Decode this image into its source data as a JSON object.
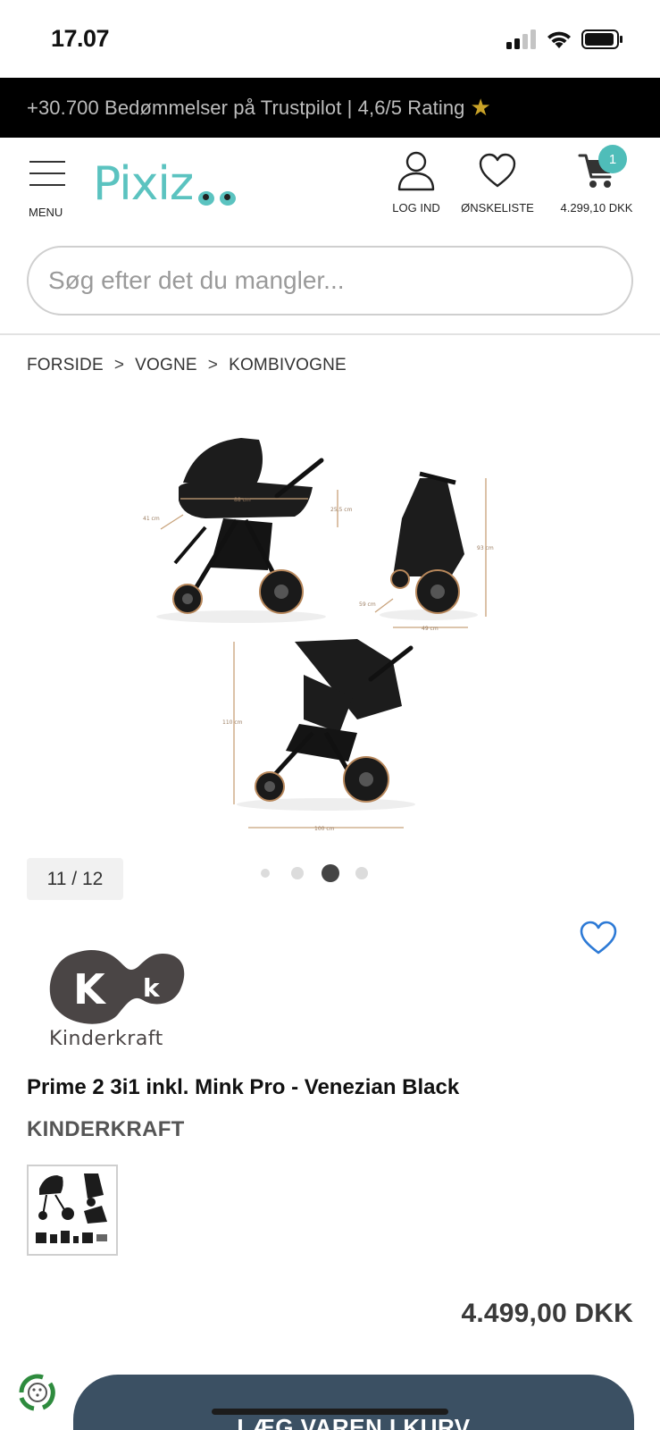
{
  "status_bar": {
    "time": "17.07",
    "icons": [
      "signal-icon",
      "wifi-icon",
      "battery-icon"
    ]
  },
  "promo": {
    "text": "+30.700 Bedømmelser på Trustpilot | 4,6/5 Rating",
    "star": "★"
  },
  "header": {
    "menu_label": "MENU",
    "logo_text": "Pixiz",
    "login_label": "LOG IND",
    "wishlist_label": "ØNSKELISTE",
    "cart_total": "4.299,10 DKK",
    "cart_count": "1",
    "brand_color": "#5bc3c0"
  },
  "search": {
    "placeholder": "Søg efter det du mangler..."
  },
  "breadcrumb": {
    "items": [
      "FORSIDE",
      "VOGNE",
      "KOMBIVOGNE"
    ],
    "separator": ">"
  },
  "gallery": {
    "counter": "11 / 12",
    "dims": {
      "carrycot_length": "88 cm",
      "carrycot_height": "25,5 cm",
      "carrycot_width": "41 cm",
      "folded_height": "93 cm",
      "folded_depth": "59 cm",
      "folded_width": "49 cm",
      "stroller_height": "110 cm",
      "stroller_length": "100 cm"
    },
    "active_dot": 2,
    "dot_count": 4
  },
  "product": {
    "brand_logo_text": "Kinderkraft",
    "title": "Prime 2 3i1 inkl. Mink Pro - Venezian Black",
    "brand": "KINDERKRAFT",
    "price": "4.499,00 DKK",
    "add_to_cart": "LÆG VAREN I KURV"
  },
  "colors": {
    "promo_bg": "#000000",
    "accent": "#4fbdb9",
    "button_bg": "#3b5063",
    "heart": "#2d7ad6"
  }
}
